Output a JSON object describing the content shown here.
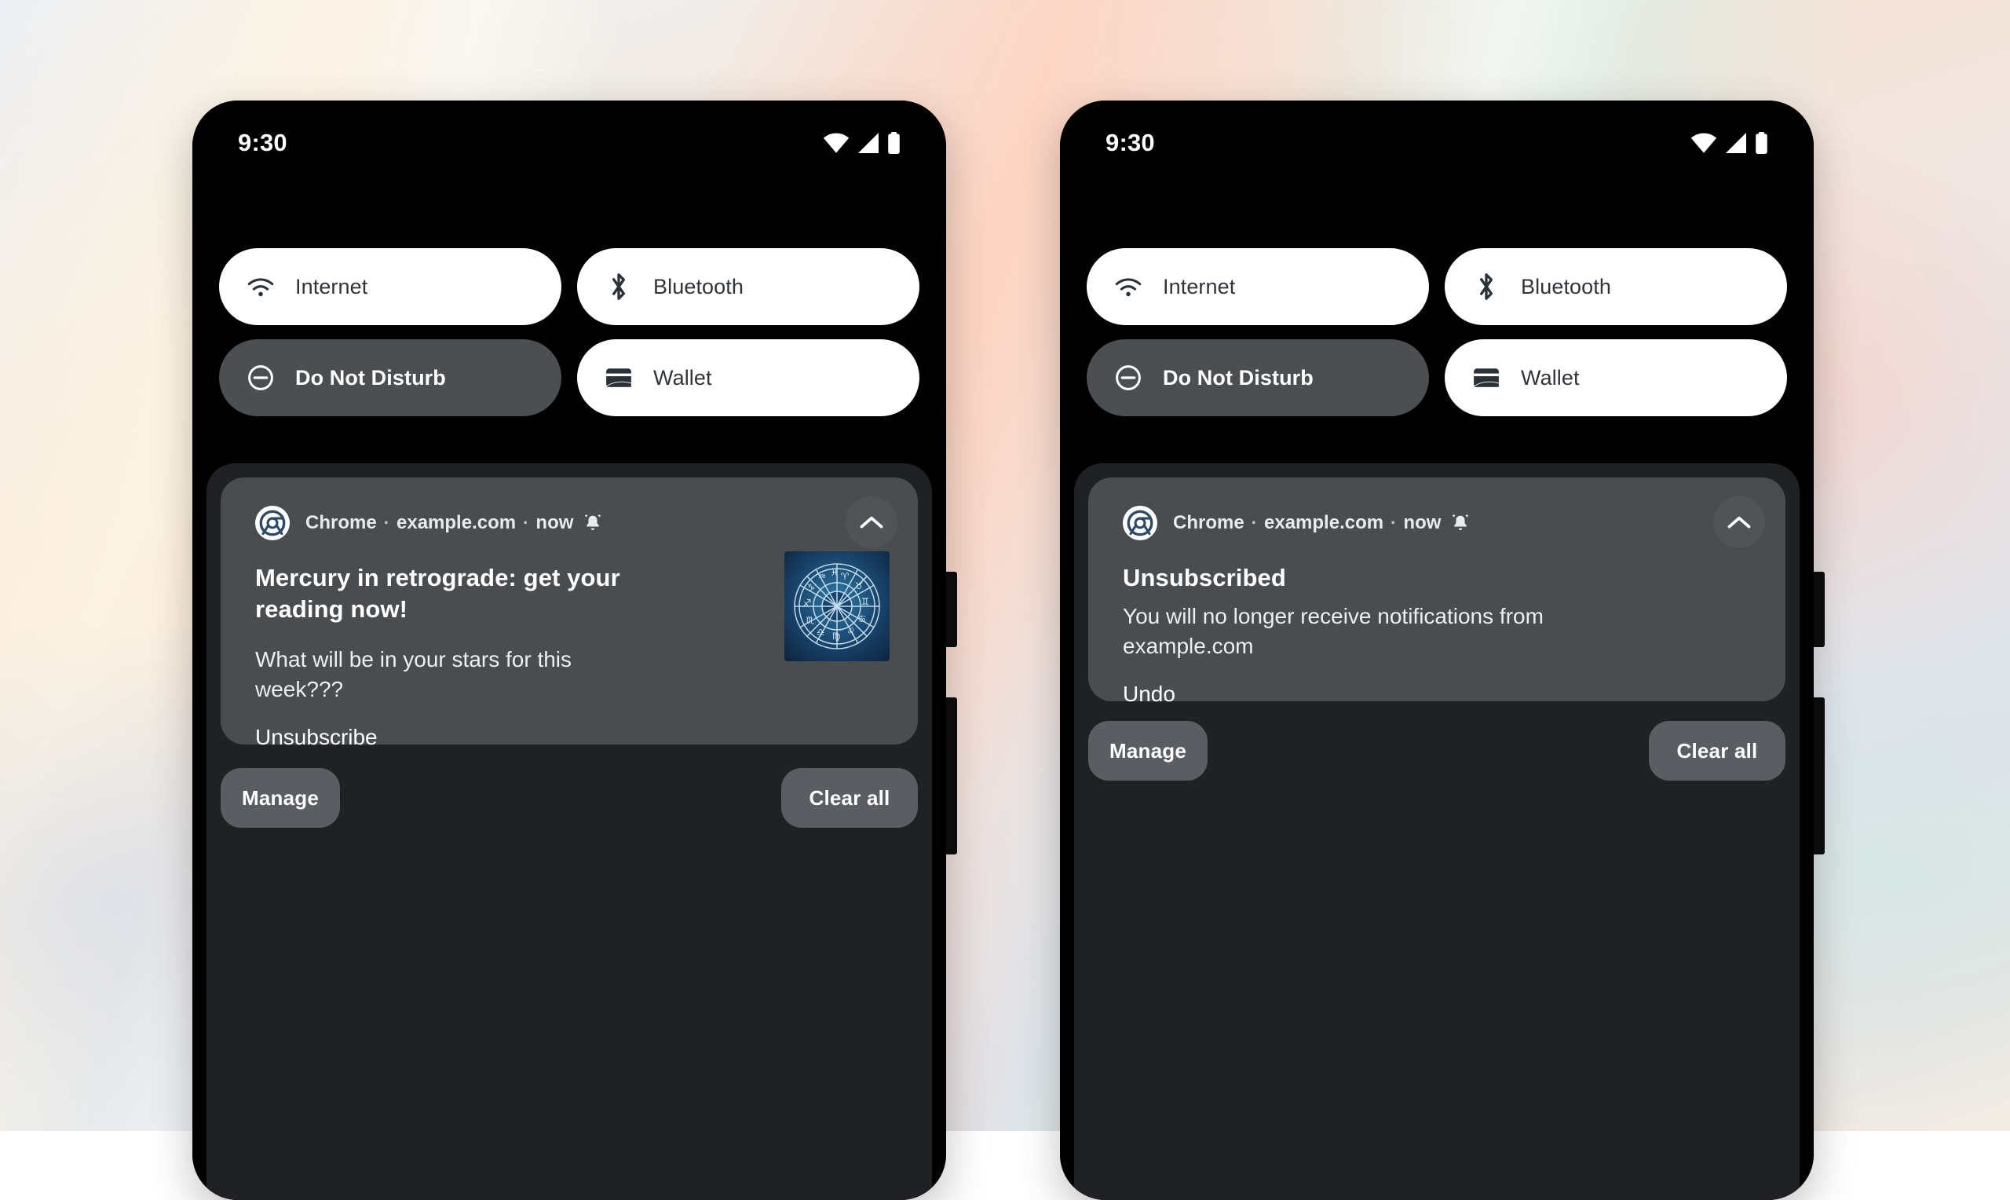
{
  "scene": {
    "description": "Two Android phone mockups side by side showing a notification shade before and after unsubscribing from web push notifications",
    "background_colors": [
      "#f6e3d6",
      "#e4eaef",
      "#eceff4",
      "#dfe3ea"
    ]
  },
  "phones": [
    {
      "id": "left",
      "status_bar": {
        "clock": "9:30",
        "icons": [
          "wifi-icon",
          "cellular-signal-icon",
          "battery-icon"
        ]
      },
      "quick_settings": {
        "tiles": [
          {
            "label": "Internet",
            "icon": "wifi-icon",
            "state": "on"
          },
          {
            "label": "Bluetooth",
            "icon": "bluetooth-icon",
            "state": "on"
          },
          {
            "label": "Do Not Disturb",
            "icon": "do-not-disturb-icon",
            "state": "off"
          },
          {
            "label": "Wallet",
            "icon": "wallet-icon",
            "state": "on"
          }
        ]
      },
      "notification": {
        "app_name": "Chrome",
        "source": "example.com",
        "time": "now",
        "separator": "·",
        "bell_icon": "ringing-bell-icon",
        "collapse_icon": "chevron-up-icon",
        "app_icon": "chrome-icon",
        "title": "Mercury in retrograde: get your reading now!",
        "body": "What will be in your stars for this week???",
        "action": "Unsubscribe",
        "thumbnail": "zodiac-wheel-image"
      },
      "footer": {
        "manage_label": "Manage",
        "clear_all_label": "Clear all"
      }
    },
    {
      "id": "right",
      "status_bar": {
        "clock": "9:30",
        "icons": [
          "wifi-icon",
          "cellular-signal-icon",
          "battery-icon"
        ]
      },
      "quick_settings": {
        "tiles": [
          {
            "label": "Internet",
            "icon": "wifi-icon",
            "state": "on"
          },
          {
            "label": "Bluetooth",
            "icon": "bluetooth-icon",
            "state": "on"
          },
          {
            "label": "Do Not Disturb",
            "icon": "do-not-disturb-icon",
            "state": "off"
          },
          {
            "label": "Wallet",
            "icon": "wallet-icon",
            "state": "on"
          }
        ]
      },
      "notification": {
        "app_name": "Chrome",
        "source": "example.com",
        "time": "now",
        "separator": "·",
        "bell_icon": "ringing-bell-icon",
        "collapse_icon": "chevron-up-icon",
        "app_icon": "chrome-icon",
        "title": "Unsubscribed",
        "body": "You will no longer receive notifications from example.com",
        "action": "Undo"
      },
      "footer": {
        "manage_label": "Manage",
        "clear_all_label": "Clear all"
      }
    }
  ]
}
